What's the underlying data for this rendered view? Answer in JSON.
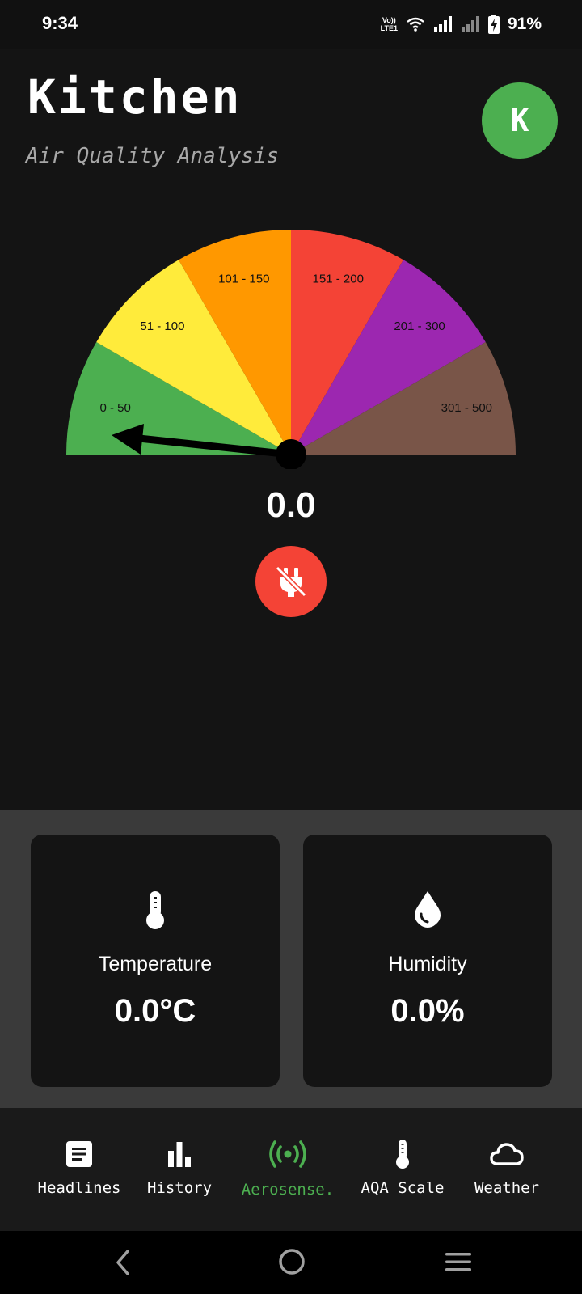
{
  "status_bar": {
    "time": "9:34",
    "volte_top": "Vo))",
    "volte_bottom": "LTE1",
    "battery": "91%"
  },
  "header": {
    "title": "Kitchen",
    "subtitle": "Air Quality Analysis",
    "avatar_letter": "K"
  },
  "gauge": {
    "segments": [
      {
        "label": "0 - 50",
        "color": "#4caf50"
      },
      {
        "label": "51 - 100",
        "color": "#ffeb3b"
      },
      {
        "label": "101 - 150",
        "color": "#ff9800"
      },
      {
        "label": "151 - 200",
        "color": "#f44336"
      },
      {
        "label": "201 - 300",
        "color": "#9c27b0"
      },
      {
        "label": "301 - 500",
        "color": "#795548"
      }
    ],
    "value": "0.0",
    "device_status_icon": "power-plug-off-icon"
  },
  "cards": {
    "temperature": {
      "label": "Temperature",
      "value": "0.0°C",
      "icon": "thermometer-icon"
    },
    "humidity": {
      "label": "Humidity",
      "value": "0.0%",
      "icon": "water-drop-icon"
    }
  },
  "bottom_nav": {
    "items": [
      {
        "label": "Headlines",
        "icon": "article-icon"
      },
      {
        "label": "History",
        "icon": "bar-chart-icon"
      },
      {
        "label": "Aerosense.",
        "icon": "sensor-signal-icon"
      },
      {
        "label": "AQA Scale",
        "icon": "thermometer-icon"
      },
      {
        "label": "Weather",
        "icon": "cloud-icon"
      }
    ],
    "active_index": 2
  },
  "colors": {
    "background": "#141414",
    "accent_green": "#4caf50",
    "alert_red": "#f44336",
    "card_section_bg": "#3a3a3a"
  }
}
